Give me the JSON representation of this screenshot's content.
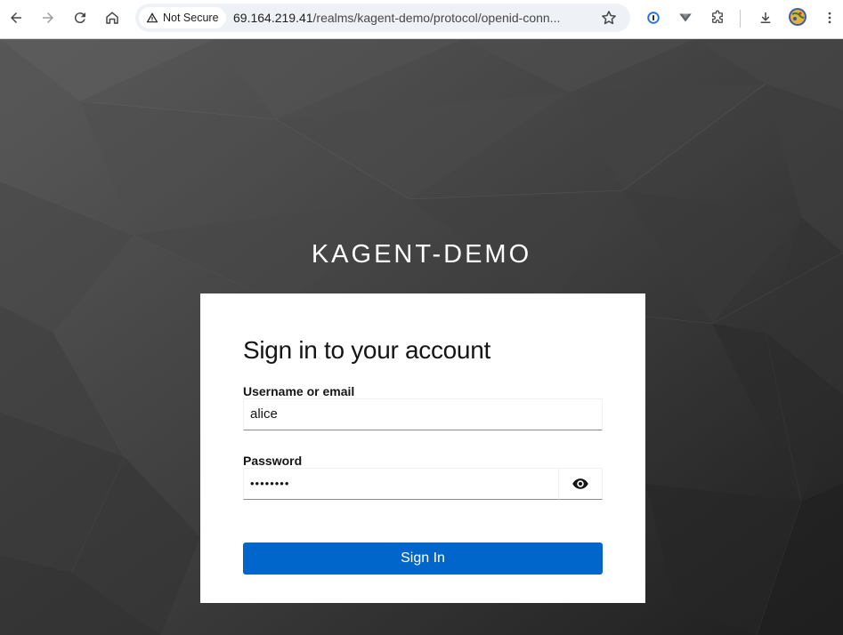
{
  "browser": {
    "security_chip": "Not Secure",
    "url_host": "69.164.219.41",
    "url_path": "/realms/kagent-demo/protocol/openid-conn..."
  },
  "icons": [
    "back-arrow-icon",
    "forward-arrow-icon",
    "reload-icon",
    "home-icon",
    "warning-icon",
    "bookmark-star-icon",
    "password-manager-icon",
    "vpn-shield-icon",
    "extensions-puzzle-icon",
    "download-icon",
    "profile-avatar-icon",
    "more-vert-icon",
    "show-password-eye-icon"
  ],
  "page": {
    "realm_name": "KAGENT-DEMO"
  },
  "form": {
    "title": "Sign in to your account",
    "username_label": "Username or email",
    "username_value": "alice",
    "password_label": "Password",
    "password_value": "••••••••",
    "submit_label": "Sign In"
  },
  "colors": {
    "primary_button": "#0066cc",
    "background": "#3b3b3b"
  }
}
